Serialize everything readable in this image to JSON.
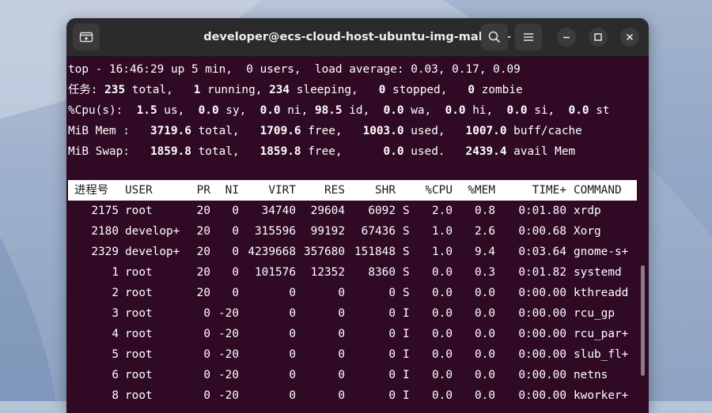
{
  "window": {
    "title": "developer@ecs-cloud-host-ubuntu-img-make: ~"
  },
  "titlebar": {
    "new_tab_icon": "new-tab-icon",
    "search_icon": "search-icon",
    "menu_icon": "hamburger-menu-icon",
    "minimize_icon": "minimize-icon",
    "maximize_icon": "maximize-icon",
    "close_icon": "close-icon"
  },
  "summary": {
    "uptime": "top - 16:46:29 up 5 min,  0 users,  load average: 0.03, 0.17, 0.09",
    "tasks": {
      "label": "任务:",
      "total": "235",
      "total_lbl": " total,   ",
      "running": "1",
      "running_lbl": " running, ",
      "sleeping": "234",
      "sleeping_lbl": " sleeping,   ",
      "stopped": "0",
      "stopped_lbl": " stopped,   ",
      "zombie": "0",
      "zombie_lbl": " zombie"
    },
    "cpu": {
      "label": "%Cpu(s):  ",
      "us": "1.5",
      "us_lbl": " us,  ",
      "sy": "0.0",
      "sy_lbl": " sy,  ",
      "ni": "0.0",
      "ni_lbl": " ni, ",
      "id": "98.5",
      "id_lbl": " id,  ",
      "wa": "0.0",
      "wa_lbl": " wa,  ",
      "hi": "0.0",
      "hi_lbl": " hi,  ",
      "si": "0.0",
      "si_lbl": " si,  ",
      "st": "0.0",
      "st_lbl": " st"
    },
    "mem": {
      "label": "MiB Mem :   ",
      "total": "3719.6",
      "total_lbl": " total,   ",
      "free": "1709.6",
      "free_lbl": " free,   ",
      "used": "1003.0",
      "used_lbl": " used,   ",
      "buff": "1007.0",
      "buff_lbl": " buff/cache"
    },
    "swap": {
      "label": "MiB Swap:   ",
      "total": "1859.8",
      "total_lbl": " total,   ",
      "free": "1859.8",
      "free_lbl": " free,      ",
      "used": "0.0",
      "used_lbl": " used.   ",
      "avail": "2439.4",
      "avail_lbl": " avail Mem"
    }
  },
  "table": {
    "columns": [
      "进程号",
      "USER",
      "PR",
      "NI",
      "VIRT",
      "RES",
      "SHR",
      "",
      "%CPU",
      "%MEM",
      "TIME+",
      "COMMAND"
    ],
    "rows": [
      [
        "2175",
        "root",
        "20",
        "0",
        "34740",
        "29604",
        "6092",
        "S",
        "2.0",
        "0.8",
        "0:01.80",
        "xrdp"
      ],
      [
        "2180",
        "develop+",
        "20",
        "0",
        "315596",
        "99192",
        "67436",
        "S",
        "1.0",
        "2.6",
        "0:00.68",
        "Xorg"
      ],
      [
        "2329",
        "develop+",
        "20",
        "0",
        "4239668",
        "357680",
        "151848",
        "S",
        "1.0",
        "9.4",
        "0:03.64",
        "gnome-s+"
      ],
      [
        "1",
        "root",
        "20",
        "0",
        "101576",
        "12352",
        "8360",
        "S",
        "0.0",
        "0.3",
        "0:01.82",
        "systemd"
      ],
      [
        "2",
        "root",
        "20",
        "0",
        "0",
        "0",
        "0",
        "S",
        "0.0",
        "0.0",
        "0:00.00",
        "kthreadd"
      ],
      [
        "3",
        "root",
        "0",
        "-20",
        "0",
        "0",
        "0",
        "I",
        "0.0",
        "0.0",
        "0:00.00",
        "rcu_gp"
      ],
      [
        "4",
        "root",
        "0",
        "-20",
        "0",
        "0",
        "0",
        "I",
        "0.0",
        "0.0",
        "0:00.00",
        "rcu_par+"
      ],
      [
        "5",
        "root",
        "0",
        "-20",
        "0",
        "0",
        "0",
        "I",
        "0.0",
        "0.0",
        "0:00.00",
        "slub_fl+"
      ],
      [
        "6",
        "root",
        "0",
        "-20",
        "0",
        "0",
        "0",
        "I",
        "0.0",
        "0.0",
        "0:00.00",
        "netns"
      ],
      [
        "8",
        "root",
        "0",
        "-20",
        "0",
        "0",
        "0",
        "I",
        "0.0",
        "0.0",
        "0:00.00",
        "kworker+"
      ]
    ]
  },
  "colors": {
    "terminal_bg": "#300a24",
    "titlebar_bg": "#2b2b2b",
    "text": "#ffffff"
  }
}
